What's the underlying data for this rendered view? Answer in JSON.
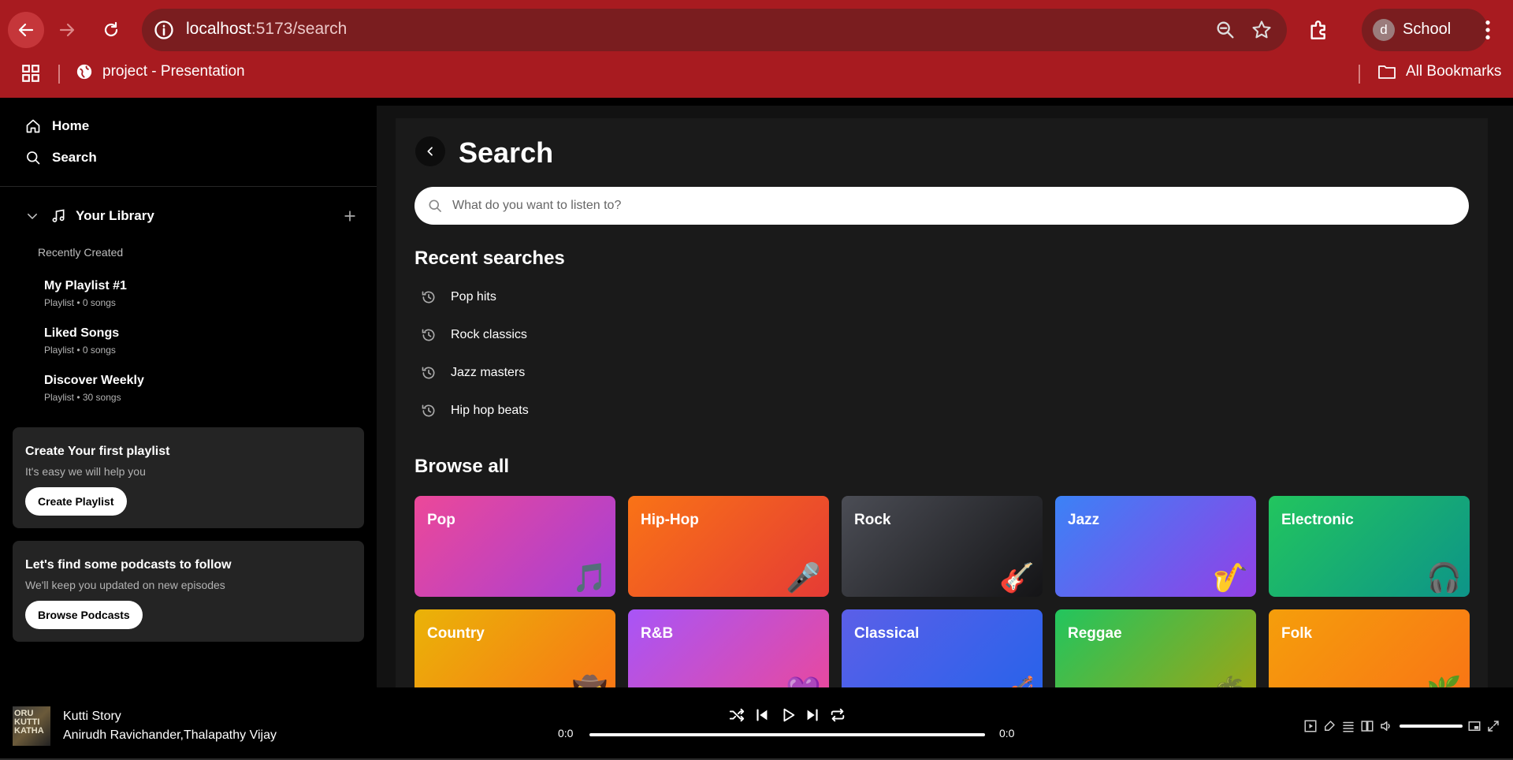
{
  "browser": {
    "url_host": "localhost",
    "url_path": ":5173/search",
    "profile_initial": "d",
    "profile_name": "School",
    "bookmark_label": "project - Presentation",
    "all_bookmarks": "All Bookmarks"
  },
  "sidebar": {
    "home": "Home",
    "search": "Search",
    "library_label": "Your Library",
    "recently_created": "Recently Created",
    "items": [
      {
        "title": "My Playlist #1",
        "subtitle": "Playlist • 0 songs"
      },
      {
        "title": "Liked Songs",
        "subtitle": "Playlist • 0 songs"
      },
      {
        "title": "Discover Weekly",
        "subtitle": "Playlist • 30 songs"
      }
    ],
    "cards": [
      {
        "title": "Create Your first playlist",
        "subtitle": "It's easy we will help you",
        "button": "Create Playlist"
      },
      {
        "title": "Let's find some podcasts to follow",
        "subtitle": "We'll keep you updated on new episodes",
        "button": "Browse Podcasts"
      }
    ]
  },
  "main": {
    "title": "Search",
    "search_placeholder": "What do you want to listen to?",
    "recent_title": "Recent searches",
    "recent": [
      "Pop hits",
      "Rock classics",
      "Jazz masters",
      "Hip hop beats"
    ],
    "browse_title": "Browse all",
    "genres": [
      {
        "name": "Pop",
        "icon": "music-notes",
        "glyph": "🎵",
        "colors": [
          "#ec4899",
          "#a63fd6"
        ]
      },
      {
        "name": "Hip-Hop",
        "icon": "microphone",
        "glyph": "🎤",
        "colors": [
          "#f97316",
          "#e53b35"
        ]
      },
      {
        "name": "Rock",
        "icon": "guitar",
        "glyph": "🎸",
        "colors": [
          "#4b4d55",
          "#141416"
        ]
      },
      {
        "name": "Jazz",
        "icon": "saxophone",
        "glyph": "🎷",
        "colors": [
          "#3b82f6",
          "#9340e6"
        ]
      },
      {
        "name": "Electronic",
        "icon": "headphones",
        "glyph": "🎧",
        "colors": [
          "#22c55e",
          "#0d9488"
        ]
      },
      {
        "name": "Country",
        "icon": "cowboy-hat",
        "glyph": "🤠",
        "colors": [
          "#eab308",
          "#f97316"
        ]
      },
      {
        "name": "R&B",
        "icon": "heart",
        "glyph": "💜",
        "colors": [
          "#a855f7",
          "#ec4899"
        ]
      },
      {
        "name": "Classical",
        "icon": "violin",
        "glyph": "🎻",
        "colors": [
          "#5b5fe8",
          "#2563eb"
        ]
      },
      {
        "name": "Reggae",
        "icon": "palm-tree",
        "glyph": "🌴",
        "colors": [
          "#22c55e",
          "#a3a312"
        ]
      },
      {
        "name": "Folk",
        "icon": "leaf",
        "glyph": "🌿",
        "colors": [
          "#f59e0b",
          "#f97316"
        ]
      }
    ]
  },
  "player": {
    "cover_text": "ORU\nKUTTI\nKATHA",
    "title": "Kutti Story",
    "artist": "Anirudh Ravichander,Thalapathy Vijay",
    "time_current": "0:0",
    "time_total": "0:0"
  }
}
